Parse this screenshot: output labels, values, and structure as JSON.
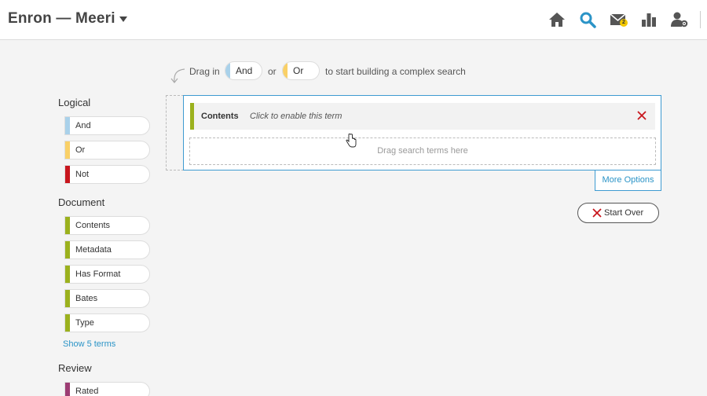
{
  "header": {
    "title": "Enron — Meeri",
    "nav": [
      {
        "name": "home-icon"
      },
      {
        "name": "search-icon",
        "color": "#2b94c7"
      },
      {
        "name": "mail-icon",
        "badge": "2"
      },
      {
        "name": "bar-chart-icon"
      },
      {
        "name": "user-settings-icon"
      }
    ]
  },
  "hint": {
    "prefix": "Drag in",
    "and_label": "And",
    "or_word": "or",
    "or_label": "Or",
    "suffix": "to start building a complex search"
  },
  "sidebar": {
    "logical": {
      "title": "Logical",
      "items": [
        {
          "label": "And",
          "color": "#a9d1ea"
        },
        {
          "label": "Or",
          "color": "#f9d067"
        },
        {
          "label": "Not",
          "color": "#c8161d"
        }
      ]
    },
    "document": {
      "title": "Document",
      "items": [
        {
          "label": "Contents",
          "color": "#9bb11d"
        },
        {
          "label": "Metadata",
          "color": "#9bb11d"
        },
        {
          "label": "Has Format",
          "color": "#9bb11d"
        },
        {
          "label": "Bates",
          "color": "#9bb11d"
        },
        {
          "label": "Type",
          "color": "#9bb11d"
        }
      ],
      "show_more": "Show 5 terms"
    },
    "review": {
      "title": "Review",
      "items": [
        {
          "label": "Rated",
          "color": "#9c3c73"
        }
      ]
    }
  },
  "builder": {
    "term_label": "Contents",
    "term_hint": "Click to enable this term",
    "drop_hint": "Drag search terms here",
    "more_options": "More Options",
    "start_over": "Start Over"
  },
  "colors": {
    "accent": "#3e9bd1",
    "close": "#c8161d"
  }
}
